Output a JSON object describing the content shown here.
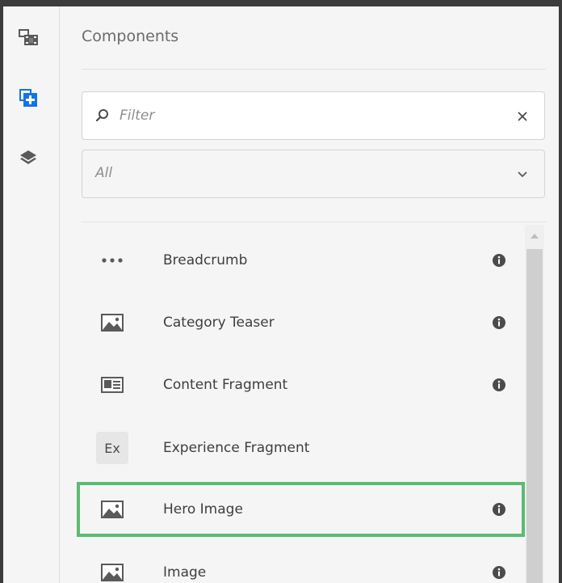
{
  "panel": {
    "title": "Components"
  },
  "filter": {
    "placeholder": "Filter",
    "value": ""
  },
  "group_select": {
    "selected": "All"
  },
  "rail": [
    {
      "name": "assets-icon"
    },
    {
      "name": "components-icon"
    },
    {
      "name": "content-tree-icon"
    }
  ],
  "components": [
    {
      "label": "Breadcrumb",
      "icon": "ellipsis-icon",
      "info": true
    },
    {
      "label": "Category Teaser",
      "icon": "image-icon",
      "info": true
    },
    {
      "label": "Content Fragment",
      "icon": "content-fragment-icon",
      "info": true
    },
    {
      "label": "Experience Fragment",
      "icon": "ex-badge",
      "badge_text": "Ex",
      "info": false
    },
    {
      "label": "Hero Image",
      "icon": "image-icon",
      "info": true,
      "selected": true
    },
    {
      "label": "Image",
      "icon": "image-icon",
      "info": true
    }
  ],
  "colors": {
    "selection": "#5bbb72",
    "rail_active": "#1473e6"
  }
}
